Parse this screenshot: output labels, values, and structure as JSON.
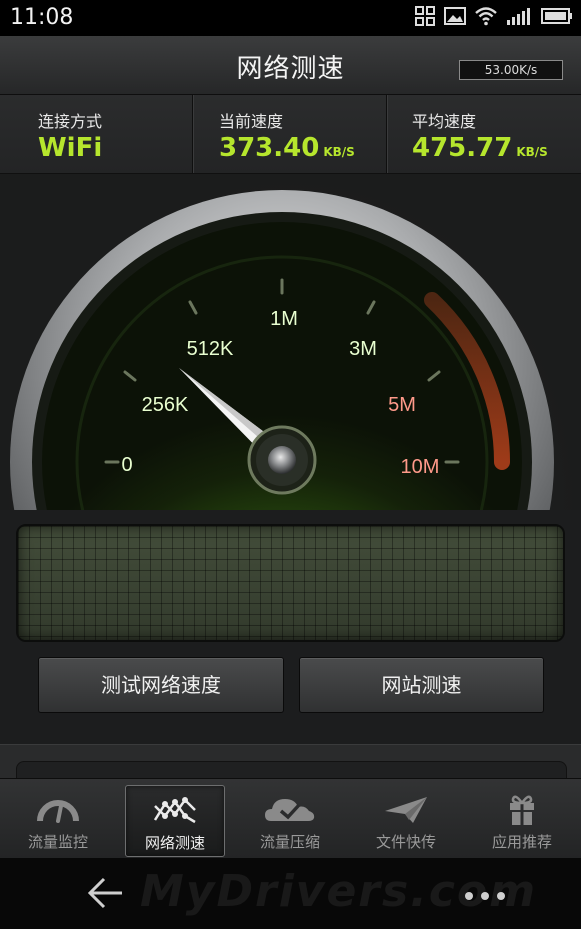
{
  "status_bar": {
    "time": "11:08",
    "icons": [
      "apps-icon",
      "image-icon",
      "wifi-icon",
      "signal-icon",
      "battery-icon"
    ]
  },
  "header": {
    "title": "网络测速",
    "speed_readout": "53.00K/s"
  },
  "stats": {
    "connection": {
      "label": "连接方式",
      "value": "WiFi"
    },
    "current": {
      "label": "当前速度",
      "value": "373.40",
      "unit": "KB/S"
    },
    "average": {
      "label": "平均速度",
      "value": "475.77",
      "unit": "KB/S"
    }
  },
  "gauge": {
    "scale_labels": [
      "0",
      "256K",
      "512K",
      "1M",
      "3M",
      "5M",
      "10M"
    ],
    "danger_labels": [
      "5M",
      "10M"
    ],
    "needle_reading": "373.40KB/S",
    "colors": {
      "accent": "#b6e62d",
      "normal_label": "#e9ffd0",
      "danger_label": "#ff9a8a"
    }
  },
  "actions": {
    "test_network": "测试网络速度",
    "test_site": "网站测速"
  },
  "tabs": [
    {
      "label": "流量监控",
      "icon": "speedometer-icon",
      "active": false
    },
    {
      "label": "网络测速",
      "icon": "network-graph-icon",
      "active": true
    },
    {
      "label": "流量压缩",
      "icon": "cloud-check-icon",
      "active": false
    },
    {
      "label": "文件快传",
      "icon": "paper-plane-icon",
      "active": false
    },
    {
      "label": "应用推荐",
      "icon": "gift-icon",
      "active": false
    }
  ],
  "navigation": {
    "watermark": "MyDrivers.com",
    "back_icon": "back-arrow-icon",
    "more_icon": "more-dots-icon"
  }
}
